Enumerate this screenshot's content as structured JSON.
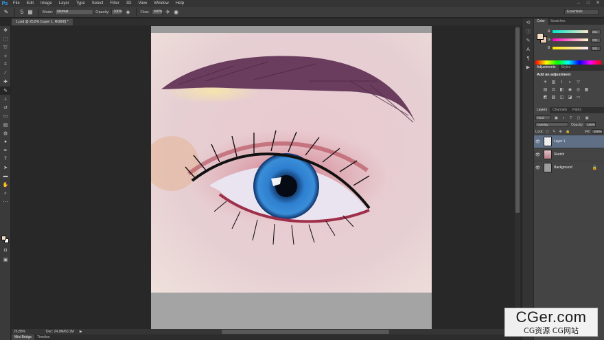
{
  "app": {
    "logo": "Ps"
  },
  "menu": [
    "File",
    "Edit",
    "Image",
    "Layer",
    "Type",
    "Select",
    "Filter",
    "3D",
    "View",
    "Window",
    "Help"
  ],
  "window_controls": [
    "–",
    "□",
    "✕"
  ],
  "options_bar": {
    "mode_label": "Mode:",
    "mode_value": "Normal",
    "opacity_label": "Opacity:",
    "opacity_value": "100%",
    "flow_label": "Flow:",
    "flow_value": "100%",
    "brush_size": "5",
    "workspace": "Essentials"
  },
  "document_tab": "1.psd @ 25,8% (Layer 1, RGB/8) *",
  "status": {
    "zoom": "25,85%",
    "doc": "Doc: 24,9M/60,1M"
  },
  "bottom_tabs": [
    "Mini Bridge",
    "Timeline"
  ],
  "color_panel": {
    "tabs": [
      "Color",
      "Swatches"
    ],
    "channels": [
      {
        "ch": "R",
        "value": "251"
      },
      {
        "ch": "G",
        "value": "231"
      },
      {
        "ch": "B",
        "value": "201"
      }
    ],
    "fg_color": "#f3ddc4"
  },
  "adjustments_panel": {
    "tabs": [
      "Adjustments",
      "Styles"
    ],
    "title": "Add an adjustment"
  },
  "layers_panel": {
    "tabs": [
      "Layers",
      "Channels",
      "Paths"
    ],
    "kind_label": "Kind",
    "blend_mode": "Overlay",
    "opacity_label": "Opacity:",
    "opacity_value": "100%",
    "lock_label": "Lock:",
    "fill_label": "Fill:",
    "fill_value": "100%",
    "layers": [
      {
        "name": "Layer 1",
        "selected": true
      },
      {
        "name": "Sketch",
        "selected": false
      },
      {
        "name": "Background",
        "selected": false,
        "locked": true
      }
    ]
  },
  "watermark": {
    "main": "CGer.com",
    "sub": "CG资源 CG网站"
  }
}
